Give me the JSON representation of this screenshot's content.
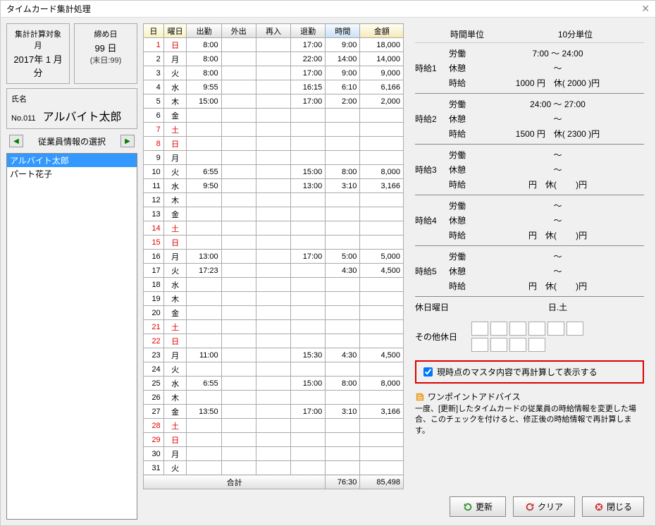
{
  "title": "タイムカード集計処理",
  "header": {
    "period_label": "集計計算対象月",
    "period_value": "2017年 1 月分",
    "closing_label": "締め日",
    "closing_value": "99 日",
    "closing_sub": "(末日:99)"
  },
  "name": {
    "label": "氏名",
    "no": "No.011",
    "value": "アルバイト太郎"
  },
  "nav_label": "従業員情報の選択",
  "employees": [
    "アルバイト太郎",
    "パート花子"
  ],
  "columns": {
    "day": "日",
    "dow": "曜日",
    "in": "出勤",
    "out1": "外出",
    "in2": "再入",
    "out": "退勤",
    "time": "時間",
    "amount": "金額"
  },
  "rows": [
    {
      "d": "1",
      "w": "日",
      "wc": "sun",
      "in": "8:00",
      "out": "17:00",
      "t": "9:00",
      "a": "18,000"
    },
    {
      "d": "2",
      "w": "月",
      "in": "8:00",
      "out": "22:00",
      "t": "14:00",
      "a": "14,000"
    },
    {
      "d": "3",
      "w": "火",
      "in": "8:00",
      "out": "17:00",
      "t": "9:00",
      "a": "9,000"
    },
    {
      "d": "4",
      "w": "水",
      "in": "9:55",
      "out": "16:15",
      "t": "6:10",
      "a": "6,166"
    },
    {
      "d": "5",
      "w": "木",
      "in": "15:00",
      "out": "17:00",
      "t": "2:00",
      "a": "2,000"
    },
    {
      "d": "6",
      "w": "金"
    },
    {
      "d": "7",
      "w": "土",
      "wc": "sat"
    },
    {
      "d": "8",
      "w": "日",
      "wc": "sun"
    },
    {
      "d": "9",
      "w": "月"
    },
    {
      "d": "10",
      "w": "火",
      "in": "6:55",
      "out": "15:00",
      "t": "8:00",
      "a": "8,000"
    },
    {
      "d": "11",
      "w": "水",
      "in": "9:50",
      "out": "13:00",
      "t": "3:10",
      "a": "3,166"
    },
    {
      "d": "12",
      "w": "木"
    },
    {
      "d": "13",
      "w": "金"
    },
    {
      "d": "14",
      "w": "土",
      "wc": "sat"
    },
    {
      "d": "15",
      "w": "日",
      "wc": "sun"
    },
    {
      "d": "16",
      "w": "月",
      "in": "13:00",
      "out": "17:00",
      "t": "5:00",
      "a": "5,000"
    },
    {
      "d": "17",
      "w": "火",
      "in": "17:23",
      "out": "",
      "t": "4:30",
      "a": "4,500"
    },
    {
      "d": "18",
      "w": "水"
    },
    {
      "d": "19",
      "w": "木"
    },
    {
      "d": "20",
      "w": "金"
    },
    {
      "d": "21",
      "w": "土",
      "wc": "sat"
    },
    {
      "d": "22",
      "w": "日",
      "wc": "sun"
    },
    {
      "d": "23",
      "w": "月",
      "in": "11:00",
      "out": "15:30",
      "t": "4:30",
      "a": "4,500"
    },
    {
      "d": "24",
      "w": "火"
    },
    {
      "d": "25",
      "w": "水",
      "in": "6:55",
      "out": "15:00",
      "t": "8:00",
      "a": "8,000"
    },
    {
      "d": "26",
      "w": "木"
    },
    {
      "d": "27",
      "w": "金",
      "in": "13:50",
      "out": "17:00",
      "t": "3:10",
      "a": "3,166"
    },
    {
      "d": "28",
      "w": "土",
      "wc": "sat"
    },
    {
      "d": "29",
      "w": "日",
      "wc": "sun"
    },
    {
      "d": "30",
      "w": "月"
    },
    {
      "d": "31",
      "w": "火"
    }
  ],
  "total": {
    "label": "合計",
    "time": "76:30",
    "amount": "85,498"
  },
  "right": {
    "unit_label": "時間単位",
    "unit_value": "10分単位",
    "wages": [
      {
        "cat": "時給1",
        "work": "7:00 ～ 24:00",
        "rest": "～",
        "rate": "1000 円　休( 2000 )円"
      },
      {
        "cat": "時給2",
        "work": "24:00 ～ 27:00",
        "rest": "～",
        "rate": "1500 円　休( 2300 )円"
      },
      {
        "cat": "時給3",
        "work": "～",
        "rest": "～",
        "rate": "円　休( 　　)円"
      },
      {
        "cat": "時給4",
        "work": "～",
        "rest": "～",
        "rate": "円　休( 　　)円"
      },
      {
        "cat": "時給5",
        "work": "～",
        "rest": "～",
        "rate": "円　休( 　　)円"
      }
    ],
    "labels": {
      "work": "労働",
      "rest": "休憩",
      "rate": "時給"
    },
    "holiday_dow_label": "休日曜日",
    "holiday_dow_value": "日.土",
    "other_holiday_label": "その他休日",
    "recalc_label": "現時点のマスタ内容で再計算して表示する",
    "tip_title": "ワンポイントアドバイス",
    "tip_text": "一度、[更新]したタイムカードの従業員の時給情報を変更した場合、このチェックを付けると、修正後の時給情報で再計算します。"
  },
  "buttons": {
    "update": "更新",
    "clear": "クリア",
    "close": "閉じる"
  }
}
